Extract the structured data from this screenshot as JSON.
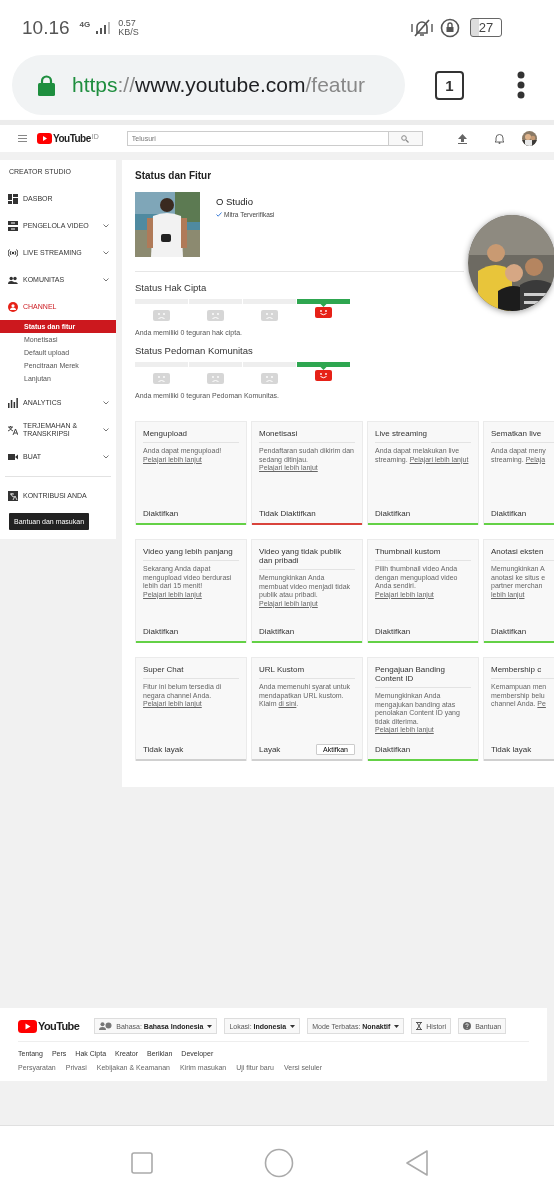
{
  "status_bar": {
    "time": "10.16",
    "network": "4G",
    "speed": "0.57",
    "speed_unit": "KB/S",
    "battery": "27"
  },
  "browser": {
    "url": {
      "scheme": "https",
      "separator": "://",
      "host": "www.youtube.com",
      "path": "/featur"
    },
    "tab_count": "1"
  },
  "header": {
    "logo": "YouTube",
    "region": "ID",
    "search": {
      "placeholder": "Telusuri"
    }
  },
  "sidebar": {
    "title": "CREATOR STUDIO",
    "items": [
      {
        "label": "DASBOR",
        "expandable": false,
        "selected": false
      },
      {
        "label": "PENGELOLA VIDEO",
        "expandable": true,
        "selected": false
      },
      {
        "label": "LIVE STREAMING",
        "expandable": true,
        "selected": false
      },
      {
        "label": "KOMUNITAS",
        "expandable": true,
        "selected": false
      },
      {
        "label": "CHANNEL",
        "expandable": false,
        "selected": true,
        "children": [
          {
            "label": "Status dan fitur",
            "selected": true
          },
          {
            "label": "Monetisasi",
            "selected": false
          },
          {
            "label": "Default upload",
            "selected": false
          },
          {
            "label": "Pencitraan Merek",
            "selected": false
          },
          {
            "label": "Lanjutan",
            "selected": false
          }
        ]
      },
      {
        "label": "ANALYTICS",
        "expandable": true,
        "selected": false
      },
      {
        "label": "TERJEMAHAN & TRANSKRIPSI",
        "expandable": true,
        "selected": false
      },
      {
        "label": "BUAT",
        "expandable": true,
        "selected": false
      }
    ],
    "contribute": "KONTRIBUSI ANDA",
    "help_button": "Bantuan dan masukan"
  },
  "main": {
    "title": "Status dan Fitur",
    "channel": {
      "name": "O Studio",
      "verified": "Mitra Terverifikasi"
    },
    "strikes": [
      {
        "title": "Status Hak Cipta",
        "segments": [
          {
            "selected": false
          },
          {
            "selected": false
          },
          {
            "selected": false
          },
          {
            "selected": true
          }
        ],
        "note": "Anda memiliki 0 teguran hak cipta."
      },
      {
        "title": "Status Pedoman Komunitas",
        "segments": [
          {
            "selected": false
          },
          {
            "selected": false
          },
          {
            "selected": false
          },
          {
            "selected": true
          }
        ],
        "note": "Anda memiliki 0 teguran Pedoman Komunitas."
      }
    ],
    "cards": [
      {
        "title": "Mengupload",
        "text": "Anda dapat mengupload! ",
        "link": "Pelajari lebih lanjut",
        "status": "Diaktifkan",
        "color": "#64d146"
      },
      {
        "title": "Monetisasi",
        "text": "Pendaftaran sudah dikirim dan sedang ditinjau. ",
        "link": "Pelajari lebih lanjut",
        "status": "Tidak Diaktifkan",
        "color": "#d9443c"
      },
      {
        "title": "Live streaming",
        "text": "Anda dapat melakukan live streaming. ",
        "link": "Pelajari lebih lanjut",
        "status": "Diaktifkan",
        "color": "#64d146"
      },
      {
        "title": "Sematkan live",
        "lines": [
          {
            "text": "Anda dapat meny"
          },
          {
            "text": "streaming. ",
            "link": "Pelaja"
          }
        ],
        "status": "Diaktifkan",
        "color": "#64d146"
      },
      {
        "title": "Video yang lebih panjang",
        "text": "Sekarang Anda dapat mengupload video berdurasi lebih dari 15 menit! ",
        "link": "Pelajari lebih lanjut",
        "status": "Diaktifkan",
        "color": "#64d146"
      },
      {
        "title": "Video yang tidak publik dan pribadi",
        "text": "Memungkinkan Anda membuat video menjadi tidak publik atau pribadi. ",
        "link": "Pelajari lebih lanjut",
        "status": "Diaktifkan",
        "color": "#64d146"
      },
      {
        "title": "Thumbnail kustom",
        "text": "Pilih thumbnail video Anda dengan mengupload video Anda sendiri. ",
        "link": "Pelajari lebih lanjut",
        "status": "Diaktifkan",
        "color": "#64d146"
      },
      {
        "title": "Anotasi eksten",
        "lines": [
          {
            "text": "Memungkinkan A"
          },
          {
            "text": "anotasi ke situs e"
          },
          {
            "text": "partner merchan"
          },
          {
            "link": "lebih lanjut"
          }
        ],
        "status": "Diaktifkan",
        "color": "#64d146"
      },
      {
        "title": "Super Chat",
        "text": "Fitur ini belum tersedia di negara channel Anda. ",
        "link": "Pelajari lebih lanjut",
        "status": "Tidak layak",
        "color": "#d0d0d0"
      },
      {
        "title": "URL Kustom",
        "text": "Anda memenuhi syarat untuk mendapatkan URL kustom. Klaim ",
        "link": "di sini",
        "after": ".",
        "status": "Layak",
        "action": "Aktifkan",
        "color": "#d0d0d0"
      },
      {
        "title": "Pengajuan Banding Content ID",
        "text": "Memungkinkan Anda mengajukan banding atas penolakan Content ID yang tidak diterima. ",
        "link": "Pelajari lebih lanjut",
        "status": "Diaktifkan",
        "color": "#64d146"
      },
      {
        "title": "Membership c",
        "lines": [
          {
            "text": "Kemampuan men"
          },
          {
            "text": "membership belu"
          },
          {
            "text": "channel Anda. ",
            "link": "Pe"
          }
        ],
        "status": "Tidak layak",
        "color": "#d0d0d0"
      }
    ]
  },
  "footer": {
    "logo": "YouTube",
    "buttons": [
      {
        "kind": "language",
        "label": "Bahasa: **Bahasa Indonesia**",
        "dropdown": true
      },
      {
        "kind": "location",
        "label": "Lokasi: **Indonesia**",
        "dropdown": true
      },
      {
        "kind": "restricted",
        "label": "Mode Terbatas: **Nonaktif**",
        "dropdown": true
      },
      {
        "kind": "history",
        "label": "Histori",
        "dropdown": false
      },
      {
        "kind": "help",
        "label": "Bantuan",
        "dropdown": false
      }
    ],
    "links": [
      "Tentang",
      "Pers",
      "Hak Cipta",
      "Kreator",
      "Beriklan",
      "Developer"
    ],
    "small_links": [
      "Persyaratan",
      "Privasi",
      "Kebijakan & Keamanan",
      "Kirim masukan",
      "Uji fitur baru",
      "Versi seluler"
    ]
  }
}
